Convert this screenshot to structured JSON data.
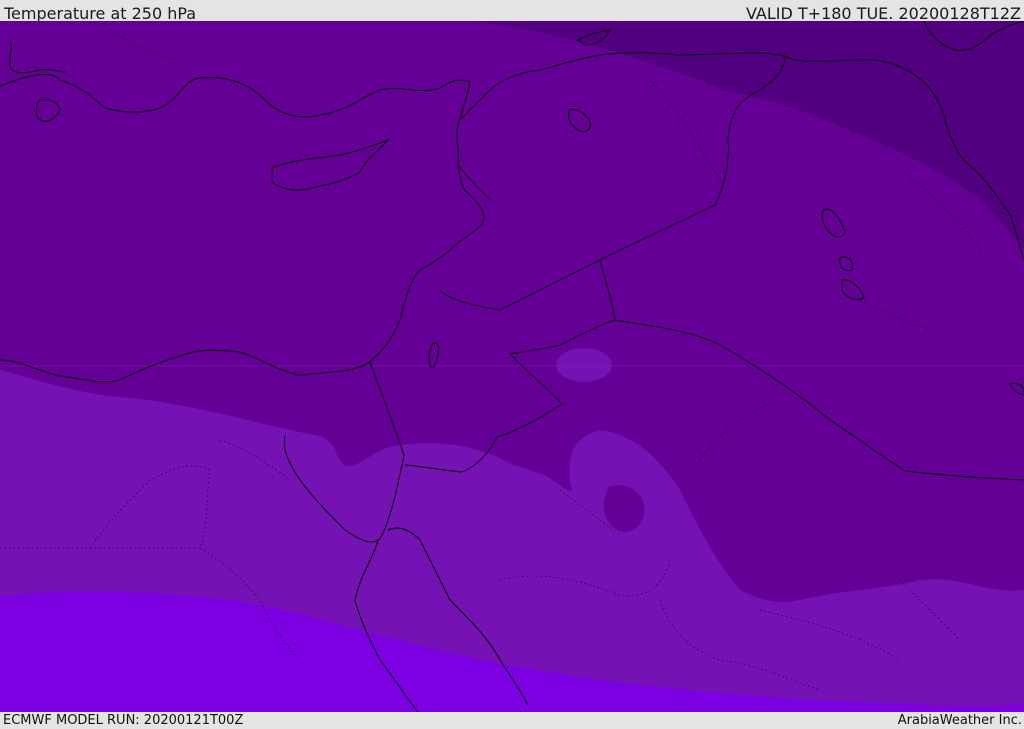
{
  "header": {
    "title": "Temperature at 250 hPa",
    "valid": "VALID T+180 TUE. 20200128T12Z"
  },
  "footer": {
    "model_run": "ECMWF MODEL RUN: 20200121T00Z",
    "credit": "ArabiaWeather Inc."
  },
  "colors": {
    "band_darkest": "#520080",
    "band_dark": "#640095",
    "band_mid": "#7512b4",
    "band_light": "#7c00e2",
    "coastline": "#000000",
    "bar_background": "#e4e4e4"
  }
}
